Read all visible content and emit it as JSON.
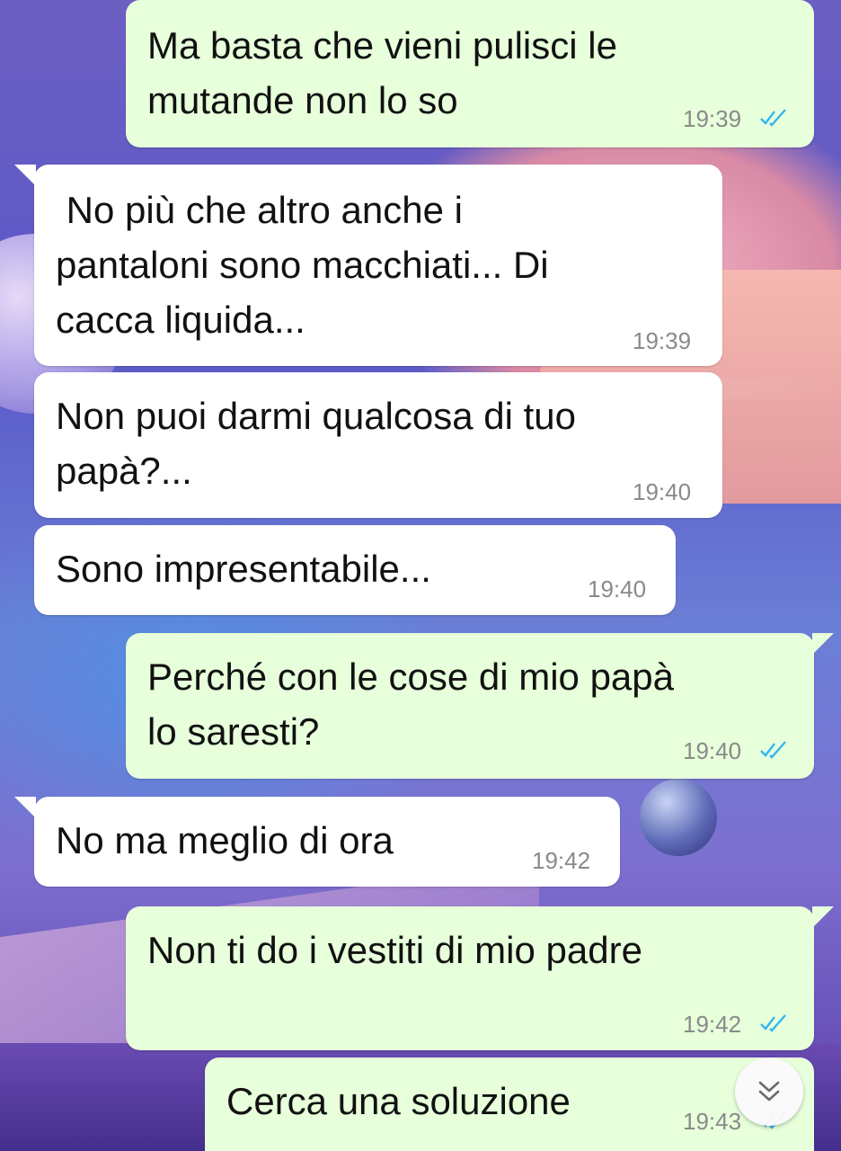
{
  "chat": {
    "messages": [
      {
        "direction": "out",
        "text": "Ma basta che vieni pulisci le\nmutande non lo so",
        "time": "19:39",
        "status": "read",
        "status_icon": "double-check-icon"
      },
      {
        "direction": "in",
        "text": " No più che altro anche i\npantaloni sono macchiati... Di\ncacca liquida...",
        "time": "19:39"
      },
      {
        "direction": "in",
        "text": "Non puoi darmi qualcosa di tuo\npapà?...",
        "time": "19:40"
      },
      {
        "direction": "in",
        "text": "Sono impresentabile...",
        "time": "19:40"
      },
      {
        "direction": "out",
        "text": "Perché con le cose di mio papà\nlo saresti?",
        "time": "19:40",
        "status": "read",
        "status_icon": "double-check-icon"
      },
      {
        "direction": "in",
        "text": "No ma meglio di ora",
        "time": "19:42"
      },
      {
        "direction": "out",
        "text": "Non ti do i vestiti di mio padre",
        "time": "19:42",
        "status": "read",
        "status_icon": "double-check-icon"
      },
      {
        "direction": "out",
        "text": "Cerca una soluzione",
        "time": "19:43",
        "status": "read",
        "status_icon": "double-check-icon"
      }
    ]
  },
  "scroll_button": {
    "icon": "chevron-double-down-icon"
  },
  "colors": {
    "outgoing_bubble": "#e7ffdb",
    "incoming_bubble": "#ffffff",
    "read_ticks": "#34b7f1",
    "timestamp": "#8a8a8a"
  }
}
